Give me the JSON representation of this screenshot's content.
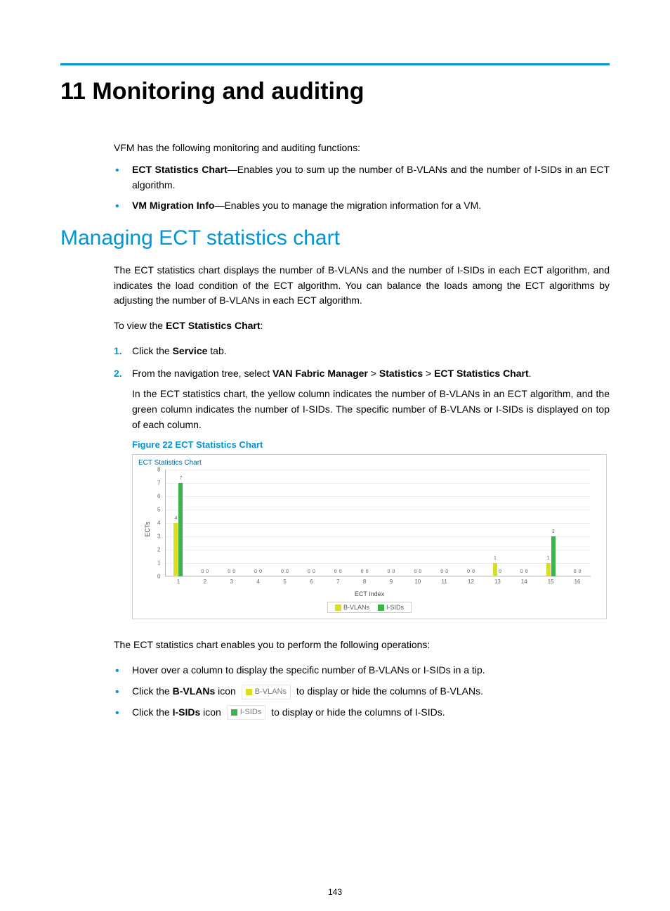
{
  "page": {
    "h1": "11 Monitoring and auditing",
    "intro": "VFM has the following monitoring and auditing functions:",
    "bullet1_bold": "ECT Statistics Chart",
    "bullet1_rest": "—Enables you to sum up the number of B-VLANs and the number of I-SIDs in an ECT algorithm.",
    "bullet2_bold": "VM Migration Info",
    "bullet2_rest": "—Enables you to manage the migration information for a VM.",
    "h2": "Managing ECT statistics chart",
    "p1": "The ECT statistics chart displays the number of B-VLANs and the number of I-SIDs in each ECT algorithm, and indicates the load condition of the ECT algorithm. You can balance the loads among the ECT algorithms by adjusting the number of B-VLANs in each ECT algorithm.",
    "p2_pre": "To view the ",
    "p2_bold": "ECT Statistics Chart",
    "p2_post": ":",
    "step1_pre": "Click the ",
    "step1_bold": "Service",
    "step1_post": " tab.",
    "step2_pre": "From the navigation tree, select ",
    "step2_b1": "VAN Fabric Manager",
    "step2_gt1": " > ",
    "step2_b2": "Statistics",
    "step2_gt2": " > ",
    "step2_b3": "ECT Statistics Chart",
    "step2_post": ".",
    "step2_para": "In the ECT statistics chart, the yellow column indicates the number of B-VLANs in an ECT algorithm, and the green column indicates the number of I-SIDs. The specific number of B-VLANs or I-SIDs is displayed on top of each column.",
    "fig_title": "Figure 22 ECT Statistics Chart",
    "chart_title": "ECT Statistics Chart",
    "ops_intro": "The ECT statistics chart enables you to perform the following operations:",
    "op_a": "Hover over a column to display the specific number of B-VLANs or I-SIDs in a tip.",
    "op_b_pre": "Click the ",
    "op_b_bold": "B-VLANs",
    "op_b_mid": " icon ",
    "op_b_icon": "B-VLANs",
    "op_b_post": " to display or hide the columns of B-VLANs.",
    "op_c_pre": "Click the ",
    "op_c_bold": "I-SIDs",
    "op_c_mid": " icon ",
    "op_c_icon": "I-SIDs",
    "op_c_post": " to display or hide the columns of I-SIDs.",
    "page_number": "143",
    "legend_bv": "B-VLANs",
    "legend_is": "I-SIDs",
    "ylabel": "ECTs",
    "xlabel": "ECT Index"
  },
  "chart_data": {
    "type": "bar",
    "title": "ECT Statistics Chart",
    "xlabel": "ECT Index",
    "ylabel": "ECTs",
    "ylim": [
      0,
      8
    ],
    "yticks": [
      0,
      1,
      2,
      3,
      4,
      5,
      6,
      7,
      8
    ],
    "categories": [
      "1",
      "2",
      "3",
      "4",
      "5",
      "6",
      "7",
      "8",
      "9",
      "10",
      "11",
      "12",
      "13",
      "14",
      "15",
      "16"
    ],
    "series": [
      {
        "name": "B-VLANs",
        "color": "#d7df23",
        "values": [
          4,
          0,
          0,
          0,
          0,
          0,
          0,
          0,
          0,
          0,
          0,
          0,
          1,
          0,
          1,
          0
        ]
      },
      {
        "name": "I-SIDs",
        "color": "#39b54a",
        "values": [
          7,
          0,
          0,
          0,
          0,
          0,
          0,
          0,
          0,
          0,
          0,
          0,
          0,
          0,
          3,
          0
        ]
      }
    ]
  }
}
